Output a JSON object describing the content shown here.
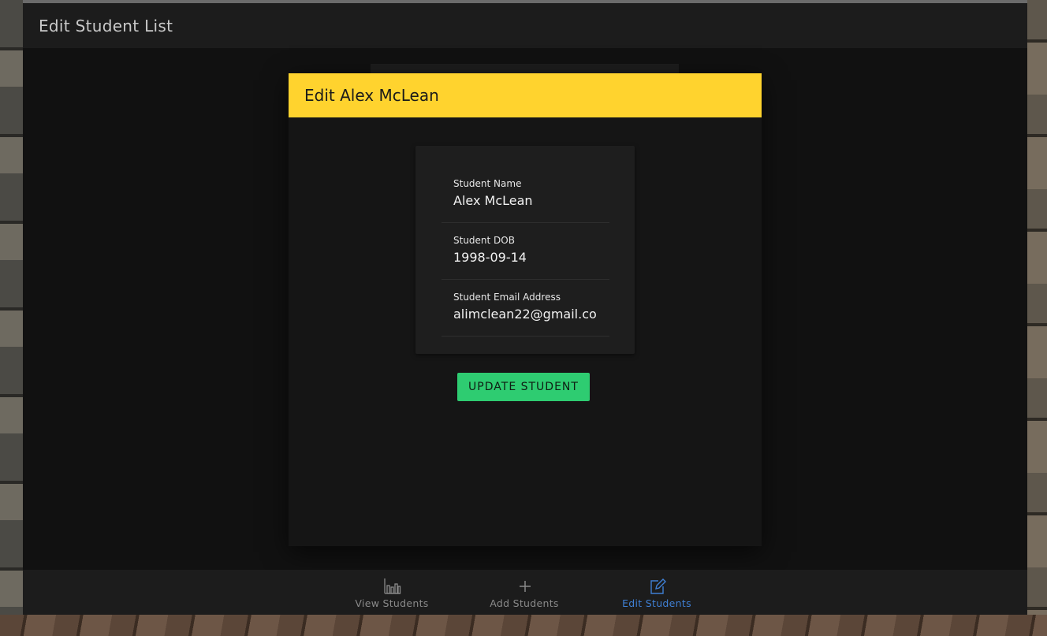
{
  "header": {
    "title": "Edit Student List"
  },
  "dialog": {
    "title": "Edit Alex McLean",
    "fields": [
      {
        "label": "Student Name",
        "value": "Alex McLean"
      },
      {
        "label": "Student DOB",
        "value": "1998-09-14"
      },
      {
        "label": "Student Email Address",
        "value": "alimclean22@gmail.co"
      }
    ],
    "submit_label": "UPDATE STUDENT"
  },
  "bottom_nav": {
    "items": [
      {
        "label": "View Students",
        "icon": "bar-chart-icon",
        "active": false
      },
      {
        "label": "Add Students",
        "icon": "plus-icon",
        "active": false
      },
      {
        "label": "Edit Students",
        "icon": "edit-icon",
        "active": true
      }
    ]
  },
  "colors": {
    "accent_header": "#ffd32e",
    "submit_button": "#2ecc71",
    "active_nav": "#3f7fd3",
    "inactive_nav": "#8a8a8a"
  }
}
